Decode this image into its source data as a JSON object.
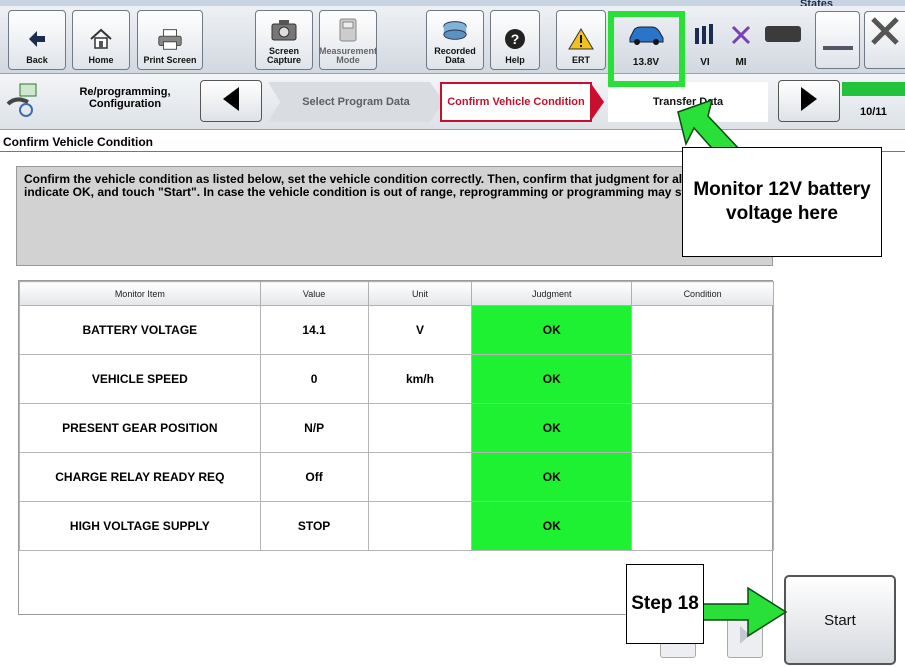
{
  "app": {
    "window_state": "States"
  },
  "toolbar": {
    "back": "Back",
    "home": "Home",
    "print_screen": "Print Screen",
    "screen_capture": "Screen Capture",
    "measurement_mode": "Measurement Mode",
    "recorded_data": "Recorded Data",
    "help": "Help",
    "ert": "ERT",
    "battery_voltage": "13.8V",
    "vi": "VI",
    "mi": "MI"
  },
  "nav": {
    "section": "Re/programming, Configuration",
    "steps": [
      {
        "label": "Select Program Data"
      },
      {
        "label": "Confirm Vehicle Condition"
      },
      {
        "label": "Transfer Data"
      }
    ],
    "progress_label": "10/11",
    "progress_fraction": 0.91
  },
  "page": {
    "title": "Confirm Vehicle Condition",
    "message": "Confirm the vehicle condition as listed below, set the vehicle condition correctly. Then, confirm that judgment for all items indicate OK, and touch \"Start\". In case the vehicle condition is out of range, reprogramming or programming may stop."
  },
  "table": {
    "headers": {
      "item": "Monitor Item",
      "value": "Value",
      "unit": "Unit",
      "judgment": "Judgment",
      "condition": "Condition"
    },
    "rows": [
      {
        "item": "BATTERY VOLTAGE",
        "value": "14.1",
        "unit": "V",
        "judgment": "OK",
        "condition": ""
      },
      {
        "item": "VEHICLE SPEED",
        "value": "0",
        "unit": "km/h",
        "judgment": "OK",
        "condition": ""
      },
      {
        "item": "PRESENT GEAR POSITION",
        "value": "N/P",
        "unit": "",
        "judgment": "OK",
        "condition": ""
      },
      {
        "item": "CHARGE RELAY READY REQ",
        "value": "Off",
        "unit": "",
        "judgment": "OK",
        "condition": ""
      },
      {
        "item": "HIGH VOLTAGE SUPPLY",
        "value": "STOP",
        "unit": "",
        "judgment": "OK",
        "condition": ""
      }
    ]
  },
  "actions": {
    "start": "Start"
  },
  "annotations": {
    "monitor_callout": "Monitor 12V battery voltage here",
    "step_label": "Step 18"
  },
  "colors": {
    "judgment_ok": "#1ef032",
    "annotation_green": "#28e038",
    "current_step_red": "#c8102e"
  }
}
